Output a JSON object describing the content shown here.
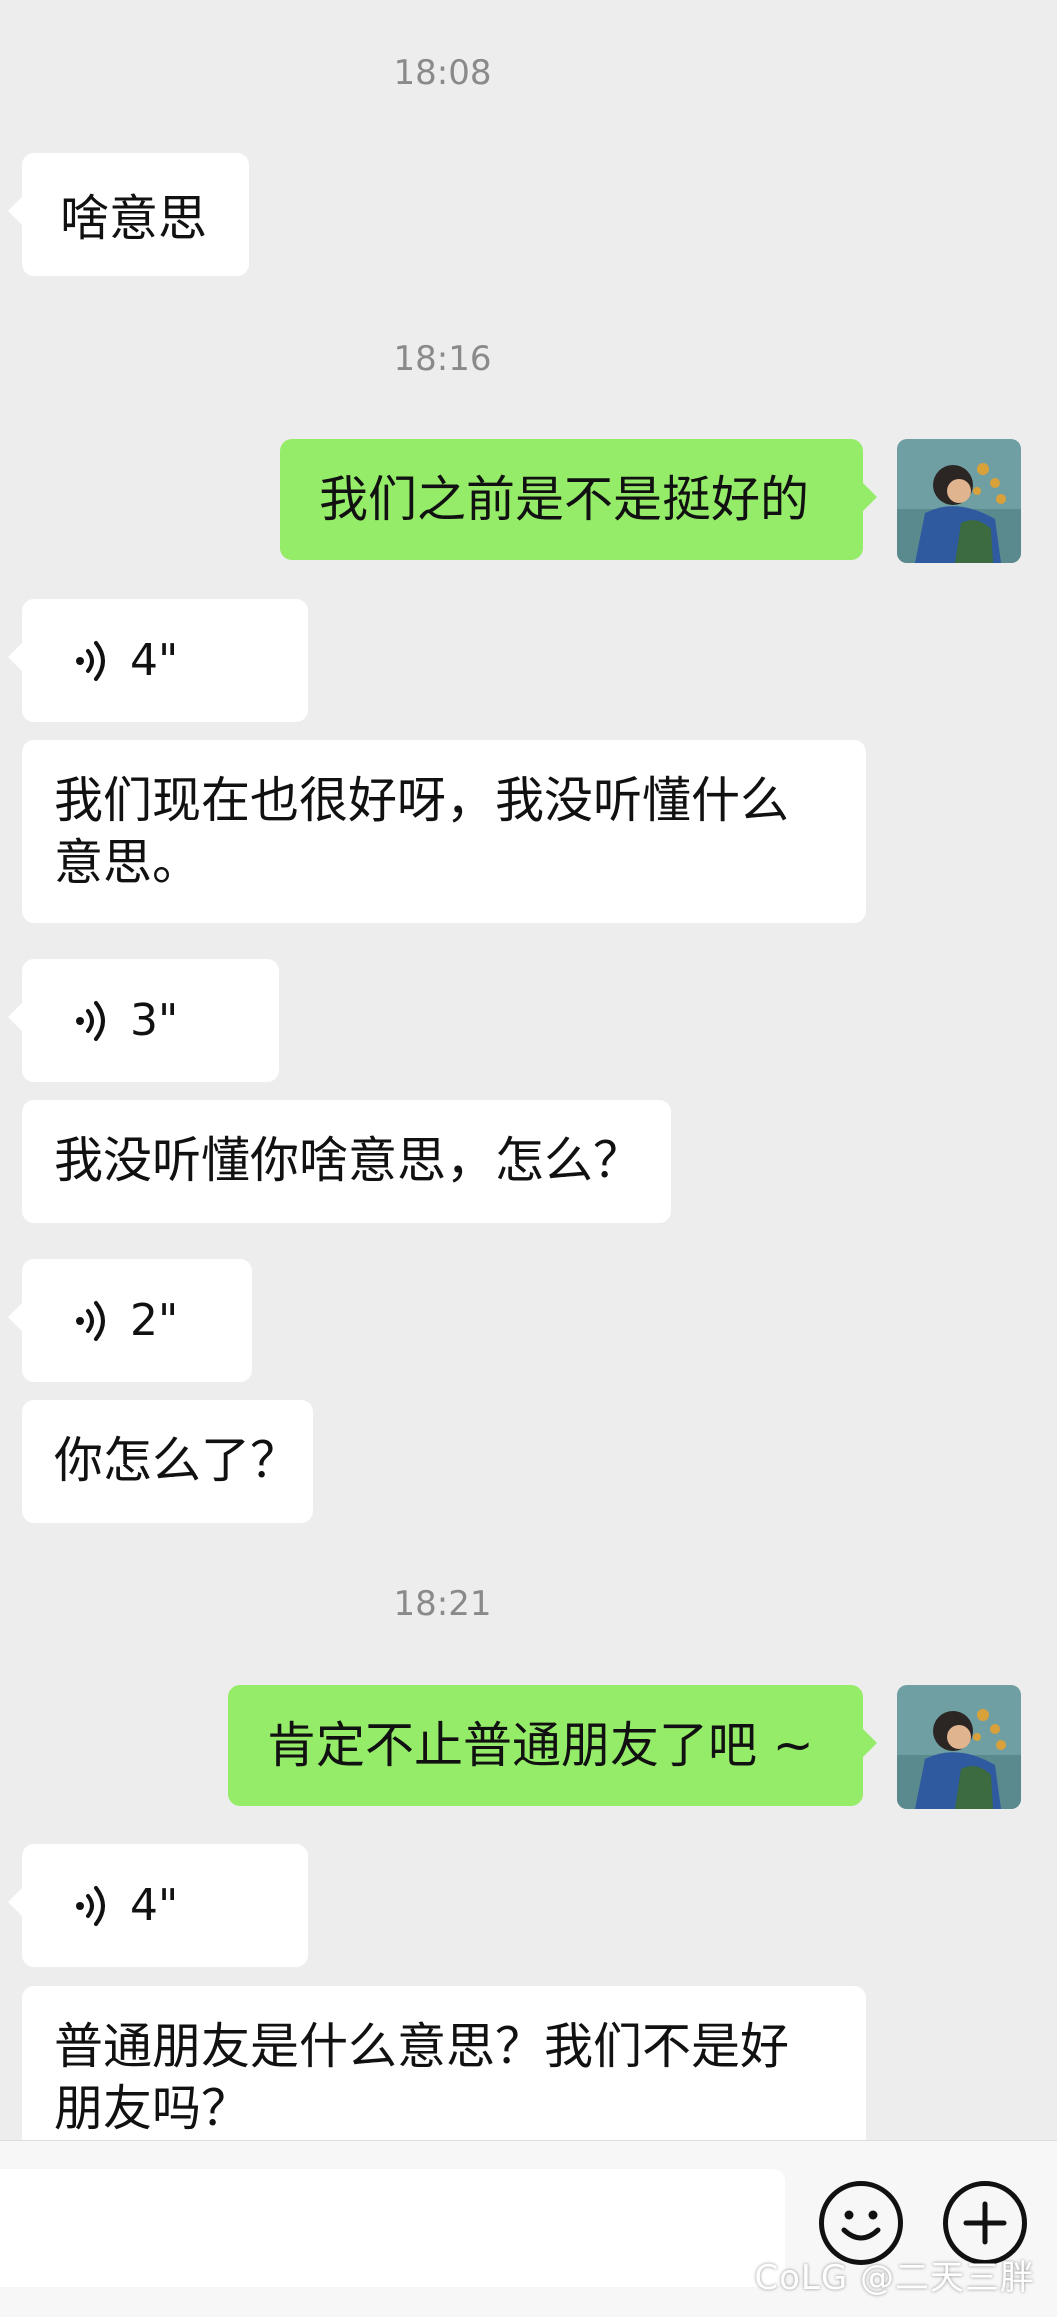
{
  "messages": [
    {
      "kind": "time",
      "text": "18:08"
    },
    {
      "kind": "text",
      "side": "in",
      "text": "啥意思"
    },
    {
      "kind": "time",
      "text": "18:16"
    },
    {
      "kind": "text",
      "side": "out",
      "text": "我们之前是不是挺好的"
    },
    {
      "kind": "voice",
      "side": "in",
      "duration": "4\""
    },
    {
      "kind": "text",
      "side": "in",
      "lines": [
        "我们现在也很好呀，我没听懂什么",
        "意思。"
      ]
    },
    {
      "kind": "voice",
      "side": "in",
      "duration": "3\""
    },
    {
      "kind": "text",
      "side": "in",
      "text": "我没听懂你啥意思，怎么？"
    },
    {
      "kind": "voice",
      "side": "in",
      "duration": "2\""
    },
    {
      "kind": "text",
      "side": "in",
      "text": "你怎么了？"
    },
    {
      "kind": "time",
      "text": "18:21"
    },
    {
      "kind": "text",
      "side": "out",
      "text": "肯定不止普通朋友了吧 ~"
    },
    {
      "kind": "voice",
      "side": "in",
      "duration": "4\""
    },
    {
      "kind": "text",
      "side": "in",
      "lines": [
        "普通朋友是什么意思？我们不是好",
        "朋友吗？"
      ]
    }
  ],
  "input": {
    "emoji_icon": "smiley-icon",
    "plus_icon": "plus-circle-icon"
  },
  "watermark": "CoLG @二天三胖",
  "colors": {
    "background": "#ededed",
    "incoming": "#ffffff",
    "outgoing": "#95ec69",
    "time": "#8a8a8a"
  }
}
